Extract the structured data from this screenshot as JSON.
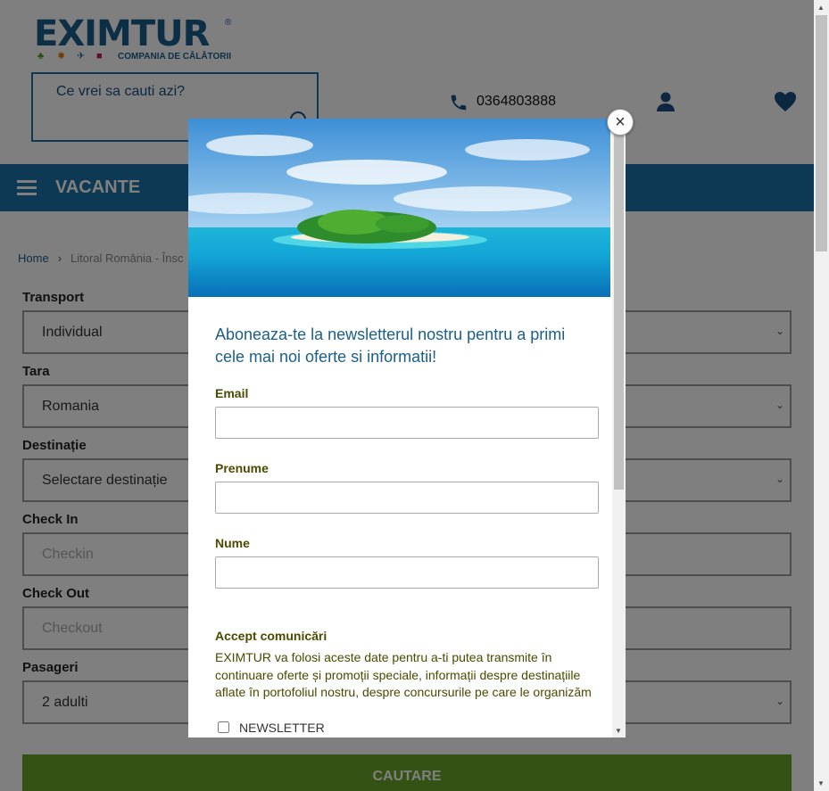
{
  "header": {
    "logo_text": "EXIMTUR",
    "logo_reg": "®",
    "logo_tagline": "COMPANIA DE CĂLĂTORII",
    "search_placeholder": "Ce vrei sa cauti azi?",
    "phone": "0364803888"
  },
  "nav": {
    "title": "VACANTE"
  },
  "breadcrumb": {
    "home": "Home",
    "separator": "›",
    "current": "Litoral România - Însc"
  },
  "form": {
    "transport": {
      "label": "Transport",
      "value": "Individual"
    },
    "tara": {
      "label": "Tara",
      "value": "Romania"
    },
    "destinatie": {
      "label": "Destinație",
      "value": "Selectare destinație"
    },
    "checkin": {
      "label": "Check In",
      "placeholder": "Checkin"
    },
    "checkout": {
      "label": "Check Out",
      "placeholder": "Checkout"
    },
    "pasageri": {
      "label": "Pasageri",
      "value": "2 adulti"
    },
    "submit_label": "CAUTARE"
  },
  "modal": {
    "heading": "Aboneaza-te la newsletterul nostru pentru a primi cele mai noi oferte si informatii!",
    "email_label": "Email",
    "prenume_label": "Prenume",
    "nume_label": "Nume",
    "consent_title": "Accept comunicări",
    "consent_text": "EXIMTUR va folosi aceste date pentru a-ti putea transmite în continuare oferte și promoții speciale, informații despre destinațiile aflate în portofoliul nostru, despre concursurile pe care le organizăm",
    "newsletter_label": "NEWSLETTER",
    "newsletter_checked": false,
    "close_symbol": "×"
  },
  "icons": [
    "phone-icon",
    "user-icon",
    "heart-icon",
    "menu-icon",
    "close-icon",
    "search-icon",
    "chevron-down-icon"
  ],
  "colors": {
    "brand": "#1a5f8c",
    "nav": "#1a73a8",
    "cta": "#6aa52b",
    "overlay": "rgba(0,0,0,0.5)"
  }
}
